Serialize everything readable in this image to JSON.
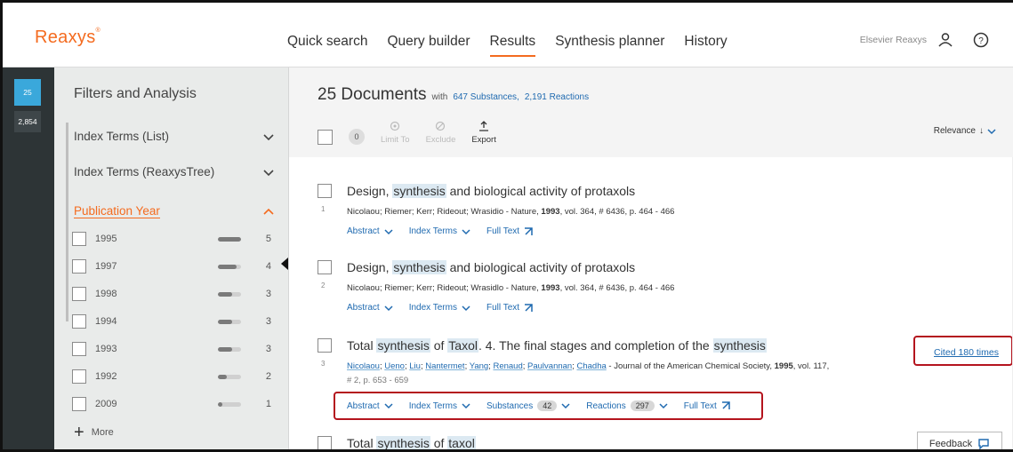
{
  "header": {
    "logo": "Reaxys",
    "nav": [
      "Quick search",
      "Query builder",
      "Results",
      "Synthesis planner",
      "History"
    ],
    "active_nav": "Results",
    "org": "Elsevier Reaxys",
    "icons": [
      "user-icon",
      "help-icon"
    ]
  },
  "rail": {
    "active_count": "25",
    "secondary_count": "2,854"
  },
  "filters": {
    "title": "Filters and Analysis",
    "sections": [
      {
        "label": "Index Terms (List)",
        "expanded": false
      },
      {
        "label": "Index Terms (ReaxysTree)",
        "expanded": false
      },
      {
        "label": "Publication Year",
        "expanded": true
      }
    ],
    "years": [
      {
        "year": "1995",
        "count": "5",
        "fraction": 1.0
      },
      {
        "year": "1997",
        "count": "4",
        "fraction": 0.8
      },
      {
        "year": "1998",
        "count": "3",
        "fraction": 0.6
      },
      {
        "year": "1994",
        "count": "3",
        "fraction": 0.6
      },
      {
        "year": "1993",
        "count": "3",
        "fraction": 0.6
      },
      {
        "year": "1992",
        "count": "2",
        "fraction": 0.4
      },
      {
        "year": "2009",
        "count": "1",
        "fraction": 0.2
      }
    ],
    "more": "More"
  },
  "results": {
    "count_label": "25 Documents",
    "with_label": "with",
    "substances_link": "647 Substances,",
    "reactions_link": "2,191 Reactions",
    "selected_count": "0",
    "limit_to": "Limit To",
    "exclude": "Exclude",
    "export": "Export",
    "sort": "Relevance",
    "items": [
      {
        "num": "1",
        "title_parts": [
          "Design, ",
          "synthesis",
          " and biological activity of protaxols"
        ],
        "authors": "Nicolaou; Riemer; Kerr; Rideout; Wrasidio",
        "source": " - Nature, ",
        "year": "1993",
        "details": ", vol. 364, # 6436, p. 464 - 466",
        "actions": [
          "Abstract",
          "Index Terms",
          "Full Text"
        ]
      },
      {
        "num": "2",
        "title_parts": [
          "Design, ",
          "synthesis",
          " and biological activity of protaxols"
        ],
        "authors": "Nicolaou; Riemer; Kerr; Rideout; Wrasidlo",
        "source": " - Nature, ",
        "year": "1993",
        "details": ", vol. 364, # 6436, p. 464 - 466",
        "actions": [
          "Abstract",
          "Index Terms",
          "Full Text"
        ]
      },
      {
        "num": "3",
        "title_parts": [
          "Total ",
          "synthesis",
          " of ",
          "Taxol",
          ". 4. The final stages and completion of the ",
          "synthesis"
        ],
        "authors": [
          "Nicolaou",
          "Ueno",
          "Liu",
          "Nantermet",
          "Yang",
          "Renaud",
          "Paulvannan",
          "Chadha"
        ],
        "source": " - Journal of the American Chemical Society, ",
        "year": "1995",
        "details": ", vol. 117,",
        "details2": "# 2, p. 653 - 659",
        "actions": [
          "Abstract",
          "Index Terms",
          "Substances",
          "Reactions",
          "Full Text"
        ],
        "substances_count": "42",
        "reactions_count": "297",
        "cited": "Cited 180 times"
      },
      {
        "title_parts": [
          "Total ",
          "synthesis",
          " of ",
          "taxol"
        ]
      }
    ],
    "feedback": "Feedback"
  }
}
